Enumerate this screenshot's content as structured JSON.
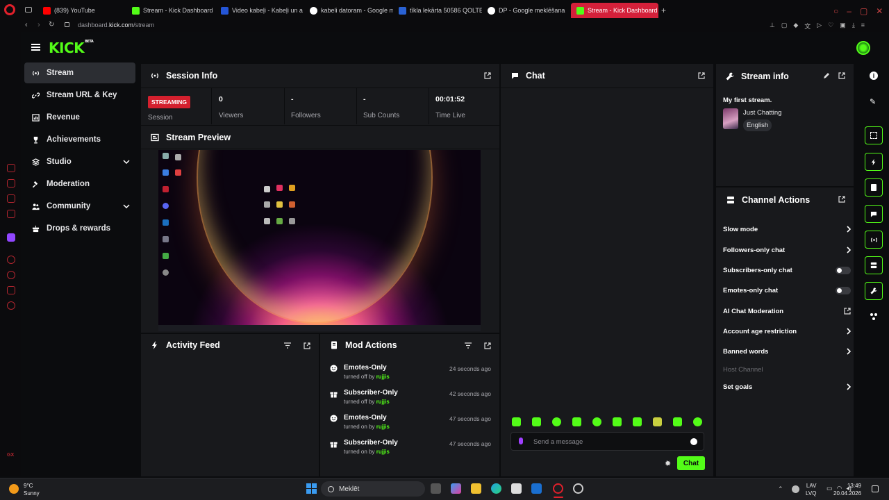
{
  "browser": {
    "tabs": [
      {
        "label": "(839) YouTube",
        "favicon_color": "#ff0000"
      },
      {
        "label": "Stream - Kick Dashboard",
        "favicon_color": "#53fc18"
      },
      {
        "label": "Video kabeļi - Kabeļi un a",
        "favicon_color": "#2455d6"
      },
      {
        "label": "kabeli datoram - Google m",
        "favicon_color": "#ffffff"
      },
      {
        "label": "tīkla lekārta 50586 QOLTE",
        "favicon_color": "#2a62d4"
      },
      {
        "label": "DP - Google meklēšana",
        "favicon_color": "#ffffff"
      },
      {
        "label": "Stream - Kick Dashboard",
        "favicon_color": "#53fc18"
      }
    ],
    "url_host": "dashboard.",
    "url_domain": "kick.com",
    "url_path": "/stream"
  },
  "header": {
    "logo": "KICK",
    "logo_sup": "BETA"
  },
  "sidebar": {
    "items": [
      {
        "label": "Stream",
        "icon": "broadcast-icon"
      },
      {
        "label": "Stream URL & Key",
        "icon": "link-icon"
      },
      {
        "label": "Revenue",
        "icon": "bar-chart-icon"
      },
      {
        "label": "Achievements",
        "icon": "trophy-icon"
      },
      {
        "label": "Studio",
        "icon": "layers-icon"
      },
      {
        "label": "Moderation",
        "icon": "hammer-icon"
      },
      {
        "label": "Community",
        "icon": "users-icon"
      },
      {
        "label": "Drops & rewards",
        "icon": "gift-icon"
      }
    ]
  },
  "session": {
    "title": "Session Info",
    "badge": "STREAMING",
    "stats": [
      {
        "value": "",
        "label": "Session"
      },
      {
        "value": "0",
        "label": "Viewers"
      },
      {
        "value": "-",
        "label": "Followers"
      },
      {
        "value": "-",
        "label": "Sub Counts"
      },
      {
        "value": "00:01:52",
        "label": "Time Live"
      }
    ]
  },
  "preview": {
    "title": "Stream Preview"
  },
  "activity": {
    "title": "Activity Feed"
  },
  "mod": {
    "title": "Mod Actions",
    "items": [
      {
        "title": "Emotes-Only",
        "action": "turned off by",
        "user": "rujjis",
        "time": "24 seconds ago"
      },
      {
        "title": "Subscriber-Only",
        "action": "turned off by",
        "user": "rujjis",
        "time": "42 seconds ago"
      },
      {
        "title": "Emotes-Only",
        "action": "turned on by",
        "user": "rujjis",
        "time": "47 seconds ago"
      },
      {
        "title": "Subscriber-Only",
        "action": "turned on by",
        "user": "rujjis",
        "time": "47 seconds ago"
      }
    ]
  },
  "chat": {
    "title": "Chat",
    "placeholder": "Send a message",
    "send_label": "Chat"
  },
  "stream_info": {
    "title": "Stream info",
    "stream_title": "My first stream.",
    "category": "Just Chatting",
    "language": "English"
  },
  "channel_actions": {
    "title": "Channel Actions",
    "items": [
      {
        "label": "Slow mode",
        "control": "arrow"
      },
      {
        "label": "Followers-only chat",
        "control": "arrow"
      },
      {
        "label": "Subscribers-only chat",
        "control": "toggle"
      },
      {
        "label": "Emotes-only chat",
        "control": "toggle"
      },
      {
        "label": "AI Chat Moderation",
        "control": "external"
      },
      {
        "label": "Account age restriction",
        "control": "arrow"
      },
      {
        "label": "Banned words",
        "control": "arrow"
      },
      {
        "label": "Host Channel",
        "control": "none"
      },
      {
        "label": "Set goals",
        "control": "arrow"
      }
    ]
  },
  "taskbar": {
    "weather_temp": "9°C",
    "weather_desc": "Sunny",
    "search_label": "Meklēt",
    "lang": "LAV",
    "lang2": "LVQ",
    "time": "13:49",
    "date": "20.04.2026"
  },
  "colors": {
    "accent": "#53fc18",
    "live": "#d4202e",
    "opera": "#e0202b"
  }
}
